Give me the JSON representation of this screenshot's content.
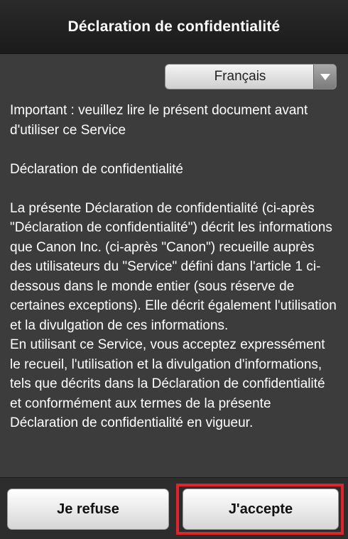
{
  "header": {
    "title": "Déclaration de confidentialité"
  },
  "language": {
    "selected": "Français"
  },
  "content": {
    "intro": "Important : veuillez lire le présent document avant d'utiliser ce Service",
    "heading": "Déclaration de confidentialité",
    "paragraph1": "La présente Déclaration de confidentialité (ci-après \"Déclaration de confidentialité\") décrit les informations que Canon Inc. (ci-après \"Canon\") recueille auprès des utilisateurs du \"Service\" défini dans l'article 1 ci-dessous dans le monde entier (sous réserve de certaines exceptions). Elle décrit également l'utilisation et la divulgation de ces informations.",
    "paragraph2": "En utilisant ce Service, vous acceptez expressément le recueil, l'utilisation et la divulgation d'informations, tels que décrits dans la Déclaration de confidentialité et conformément aux termes de la présente Déclaration de confidentialité en vigueur."
  },
  "footer": {
    "refuse_label": "Je refuse",
    "accept_label": "J'accepte"
  },
  "colors": {
    "background": "#3c3c3c",
    "header": "#1b1b1b",
    "highlight": "#e0242b"
  }
}
